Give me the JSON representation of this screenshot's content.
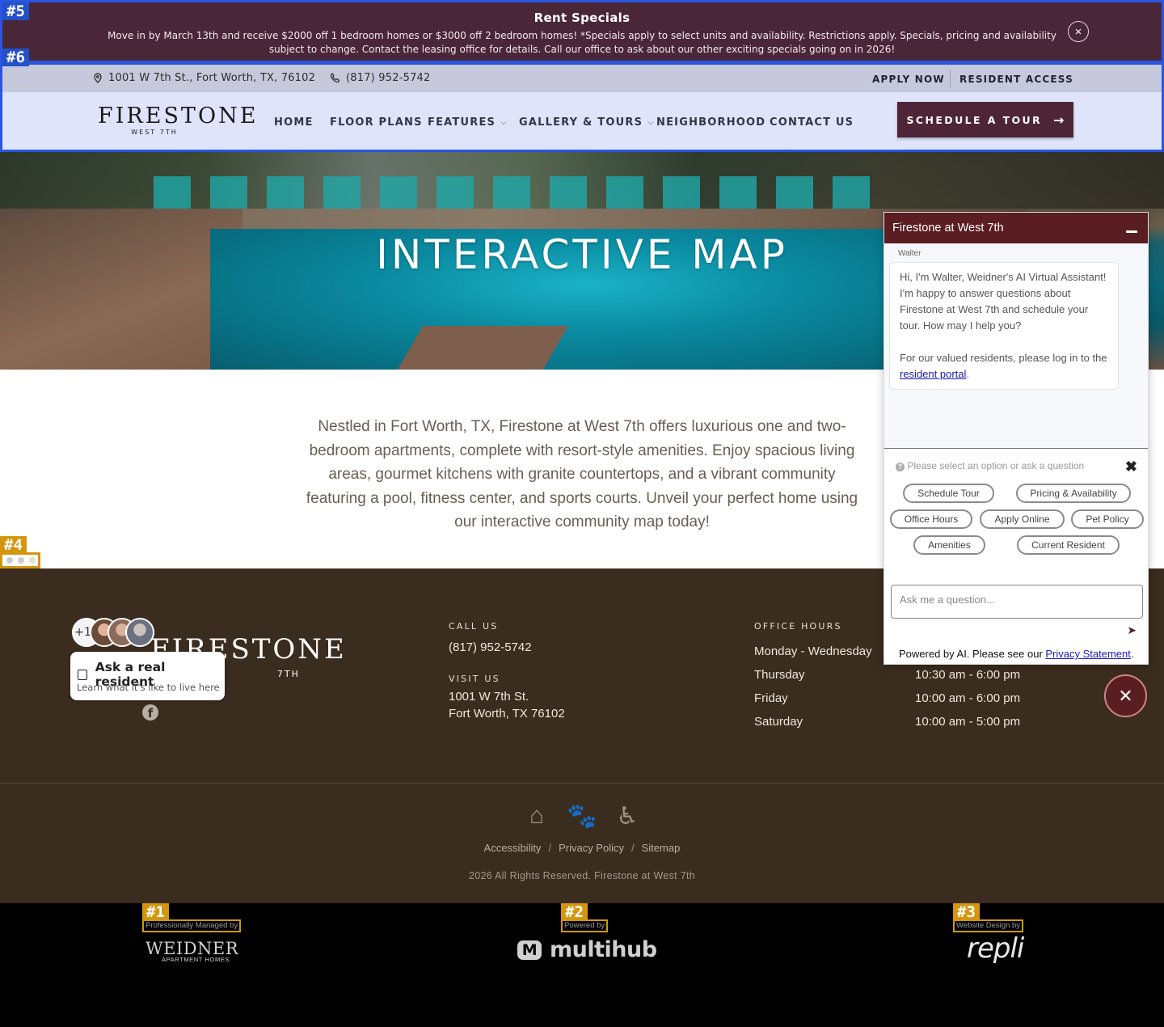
{
  "overlay_tags": {
    "t1": "#1",
    "t2": "#2",
    "t3": "#3",
    "t4": "#4",
    "t5": "#5",
    "t6": "#6"
  },
  "specials": {
    "title": "Rent Specials",
    "text": "Move in by March 13th and receive $2000 off 1 bedroom homes or $3000 off 2 bedroom homes! *Specials apply to select units and availability. Restrictions apply. Specials, pricing and availability subject to change. Contact the leasing office for details. Call our office to ask about our other exciting specials going on in 2026!",
    "close_icon": "×"
  },
  "topbar": {
    "address": "1001 W 7th St., Fort Worth, TX, 76102",
    "phone": "(817) 952-5742",
    "apply_now": "APPLY NOW",
    "resident_access": "RESIDENT ACCESS"
  },
  "logo": {
    "name": "FIRESTONE",
    "sub": "WEST 7TH"
  },
  "nav": {
    "home": "HOME",
    "floor_plans": "FLOOR PLANS",
    "features": "FEATURES",
    "gallery": "GALLERY & TOURS",
    "neighborhood": "NEIGHBORHOOD",
    "contact": "CONTACT US",
    "chevron": "⌵",
    "tour_button": "SCHEDULE A TOUR",
    "tour_arrow": "→"
  },
  "hero": {
    "title": "INTERACTIVE MAP"
  },
  "intro": {
    "text": "Nestled in Fort Worth, TX, Firestone at West 7th offers luxurious one and two-bedroom apartments, complete with resort-style amenities. Enjoy spacious living areas, gourmet kitchens with granite countertops, and a vibrant community featuring a pool, fitness center, and sports courts. Unveil your perfect home using our interactive community map today!"
  },
  "footer": {
    "logo_name": "FIRESTONE",
    "logo_sub": "7TH",
    "facebook": "f",
    "call_label": "CALL US",
    "phone": "(817) 952-5742",
    "visit_label": "VISIT US",
    "address_line1": "1001 W 7th St.",
    "address_line2": "Fort Worth, TX 76102",
    "hours_label": "OFFICE HOURS",
    "hours": [
      {
        "day": "Monday - Wednesday",
        "time": ""
      },
      {
        "day": "Thursday",
        "time": "10:30 am - 6:00 pm"
      },
      {
        "day": "Friday",
        "time": "10:00 am - 6:00 pm"
      },
      {
        "day": "Saturday",
        "time": "10:00 am - 5:00 pm"
      }
    ],
    "icons": {
      "housing": "⌂",
      "pet": "🐾",
      "accessible": "♿"
    },
    "links": {
      "accessibility": "Accessibility",
      "privacy": "Privacy Policy",
      "sitemap": "Sitemap",
      "slash": "/"
    },
    "copyright": "2026 All Rights Reserved. Firestone at West 7th"
  },
  "credits": {
    "managed_label": "Professionally Managed by",
    "weidner": "WEIDNER",
    "weidner_sub": "APARTMENT HOMES",
    "powered_label": "Powered by",
    "multihub_mark": "M",
    "multihub": "multihub",
    "design_label": "Website Design by",
    "repli": "repli"
  },
  "chat": {
    "title": "Firestone at West 7th",
    "agent": "Walter",
    "greeting": "Hi, I'm Walter, Weidner's AI Virtual Assistant! I'm happy to answer questions about Firestone at West 7th and schedule your tour. How may I help you?",
    "residents_prefix": "For our valued residents, please log in to the ",
    "residents_link": "resident portal",
    "residents_suffix": ".",
    "prompt": "Please select an option or ask a question",
    "prompt_icon": "?",
    "close_icon": "✖",
    "options": [
      "Schedule Tour",
      "Pricing & Availability",
      "Office Hours",
      "Apply Online",
      "Pet Policy",
      "Amenities",
      "Current Resident"
    ],
    "input_placeholder": "Ask me a question...",
    "send_icon": "➤",
    "footer_prefix": "Powered by AI. Please see our ",
    "footer_link": "Privacy Statement",
    "footer_suffix": ".",
    "toggle_icon": "✕"
  },
  "resident": {
    "count": "+12",
    "title": "Ask a real resident",
    "subtitle": "Learn what it's like to live here"
  },
  "colors": {
    "brand": "#4d2536",
    "chat_header": "#5a1d21",
    "footer_bg": "#3a2c1e",
    "highlight_blue": "#2a55e0",
    "highlight_gold": "#d4960f"
  }
}
